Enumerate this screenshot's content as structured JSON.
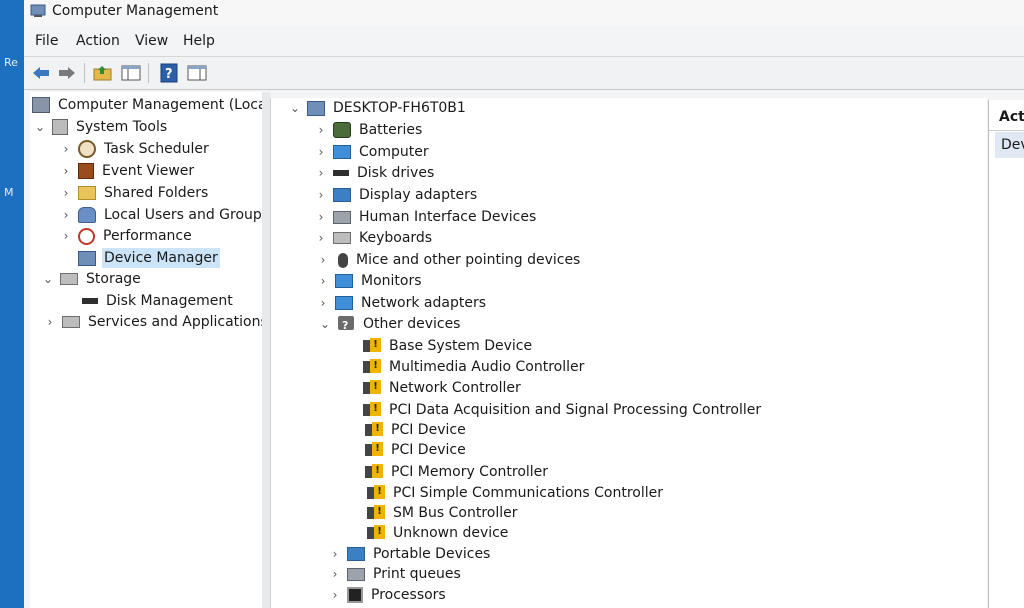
{
  "window": {
    "title": "Computer Management"
  },
  "desktop": {
    "left_edge_labels": [
      "Re",
      "M"
    ]
  },
  "menu": [
    "File",
    "Action",
    "View",
    "Help"
  ],
  "toolbar": {
    "buttons": [
      {
        "icon": "back-arrow-icon"
      },
      {
        "icon": "forward-arrow-icon"
      },
      {
        "icon": "up-folder-icon"
      },
      {
        "icon": "show-hide-tree-icon"
      },
      {
        "icon": "help-icon"
      },
      {
        "icon": "show-hide-action-pane-icon"
      }
    ]
  },
  "left_tree": [
    {
      "label": "Computer Management (Local)",
      "level": 0,
      "chevron": "",
      "icon": "computer-management-icon"
    },
    {
      "label": "System Tools",
      "level": 1,
      "chevron": "v",
      "icon": "system-tools-icon"
    },
    {
      "label": "Task Scheduler",
      "level": 2,
      "chevron": ">",
      "icon": "task-scheduler-icon"
    },
    {
      "label": "Event Viewer",
      "level": 2,
      "chevron": ">",
      "icon": "event-viewer-icon"
    },
    {
      "label": "Shared Folders",
      "level": 2,
      "chevron": ">",
      "icon": "shared-folders-icon"
    },
    {
      "label": "Local Users and Groups",
      "level": 2,
      "chevron": ">",
      "icon": "local-users-icon"
    },
    {
      "label": "Performance",
      "level": 2,
      "chevron": ">",
      "icon": "performance-icon"
    },
    {
      "label": "Device Manager",
      "level": 2,
      "chevron": "",
      "icon": "device-manager-icon",
      "selected": true
    },
    {
      "label": "Storage",
      "level": 1,
      "chevron": "v",
      "icon": "storage-icon"
    },
    {
      "label": "Disk Management",
      "level": 2,
      "chevron": "",
      "icon": "disk-management-icon"
    },
    {
      "label": "Services and Applications",
      "level": 1,
      "chevron": ">",
      "icon": "services-icon"
    }
  ],
  "device_tree": [
    {
      "label": "DESKTOP-FH6T0B1",
      "level": 0,
      "chevron": "v",
      "icon": "computer-root-icon"
    },
    {
      "label": "Batteries",
      "level": 1,
      "chevron": ">",
      "icon": "batteries-icon"
    },
    {
      "label": "Computer",
      "level": 1,
      "chevron": ">",
      "icon": "computer-icon"
    },
    {
      "label": "Disk drives",
      "level": 1,
      "chevron": ">",
      "icon": "disk-drive-icon"
    },
    {
      "label": "Display adapters",
      "level": 1,
      "chevron": ">",
      "icon": "display-adapter-icon"
    },
    {
      "label": "Human Interface Devices",
      "level": 1,
      "chevron": ">",
      "icon": "hid-icon"
    },
    {
      "label": "Keyboards",
      "level": 1,
      "chevron": ">",
      "icon": "keyboard-icon"
    },
    {
      "label": "Mice and other pointing devices",
      "level": 1,
      "chevron": ">",
      "icon": "mouse-icon"
    },
    {
      "label": "Monitors",
      "level": 1,
      "chevron": ">",
      "icon": "monitor-icon"
    },
    {
      "label": "Network adapters",
      "level": 1,
      "chevron": ">",
      "icon": "network-adapter-icon"
    },
    {
      "label": "Other devices",
      "level": 1,
      "chevron": "v",
      "icon": "other-devices-icon"
    },
    {
      "label": "Base System Device",
      "level": 2,
      "chevron": "",
      "icon": "warning-device-icon"
    },
    {
      "label": "Multimedia Audio Controller",
      "level": 2,
      "chevron": "",
      "icon": "warning-device-icon"
    },
    {
      "label": "Network Controller",
      "level": 2,
      "chevron": "",
      "icon": "warning-device-icon"
    },
    {
      "label": "PCI Data Acquisition and Signal Processing Controller",
      "level": 2,
      "chevron": "",
      "icon": "warning-device-icon"
    },
    {
      "label": "PCI Device",
      "level": 2,
      "chevron": "",
      "icon": "warning-device-icon"
    },
    {
      "label": "PCI Device",
      "level": 2,
      "chevron": "",
      "icon": "warning-device-icon"
    },
    {
      "label": "PCI Memory Controller",
      "level": 2,
      "chevron": "",
      "icon": "warning-device-icon"
    },
    {
      "label": "PCI Simple Communications Controller",
      "level": 2,
      "chevron": "",
      "icon": "warning-device-icon"
    },
    {
      "label": "SM Bus Controller",
      "level": 2,
      "chevron": "",
      "icon": "warning-device-icon"
    },
    {
      "label": "Unknown device",
      "level": 2,
      "chevron": "",
      "icon": "warning-device-icon"
    },
    {
      "label": "Portable Devices",
      "level": 1,
      "chevron": ">",
      "icon": "portable-devices-icon"
    },
    {
      "label": "Print queues",
      "level": 1,
      "chevron": ">",
      "icon": "print-queue-icon"
    },
    {
      "label": "Processors",
      "level": 1,
      "chevron": ">",
      "icon": "processor-icon"
    }
  ],
  "actions_pane": {
    "header": "Acti",
    "item": "Dev"
  }
}
